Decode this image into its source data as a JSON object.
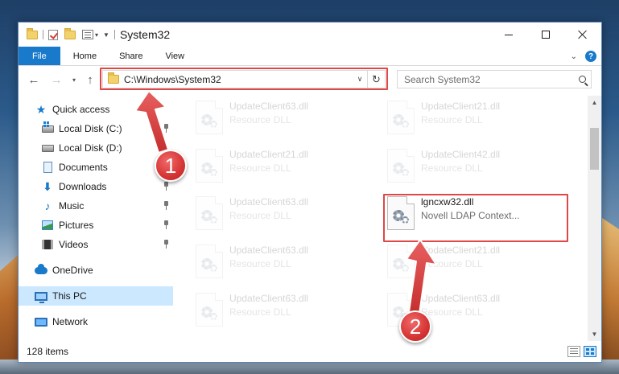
{
  "window": {
    "title": "System32"
  },
  "ribbon": {
    "tabs": [
      {
        "label": "File"
      },
      {
        "label": "Home"
      },
      {
        "label": "Share"
      },
      {
        "label": "View"
      }
    ],
    "help": "?"
  },
  "navbar": {
    "address": "C:\\Windows\\System32",
    "search_placeholder": "Search System32"
  },
  "navpane": {
    "items": [
      {
        "label": "Quick access",
        "icon": "star-icon"
      },
      {
        "label": "Local Disk (C:)",
        "icon": "local-disk-c-icon",
        "pinned": true
      },
      {
        "label": "Local Disk (D:)",
        "icon": "local-disk-d-icon"
      },
      {
        "label": "Documents",
        "icon": "documents-icon",
        "pinned": true
      },
      {
        "label": "Downloads",
        "icon": "downloads-icon",
        "pinned": true
      },
      {
        "label": "Music",
        "icon": "music-icon",
        "pinned": true
      },
      {
        "label": "Pictures",
        "icon": "pictures-icon",
        "pinned": true
      },
      {
        "label": "Videos",
        "icon": "videos-icon",
        "pinned": true
      },
      {
        "label": "OneDrive",
        "icon": "onedrive-icon"
      },
      {
        "label": "This PC",
        "icon": "this-pc-icon",
        "selected": true
      },
      {
        "label": "Network",
        "icon": "network-icon"
      }
    ]
  },
  "files": [
    {
      "name": "UpdateClient63.dll",
      "type": "Resource DLL",
      "faded": true
    },
    {
      "name": "UpdateClient21.dll",
      "type": "Resource DLL",
      "faded": true
    },
    {
      "name": "UpdateClient21.dll",
      "type": "Resource DLL",
      "faded": true
    },
    {
      "name": "UpdateClient42.dll",
      "type": "Resource DLL",
      "faded": true
    },
    {
      "name": "UpdateClient63.dll",
      "type": "Resource DLL",
      "faded": true
    },
    {
      "name": "lgncxw32.dll",
      "type": "Novell LDAP Context...",
      "faded": false
    },
    {
      "name": "UpdateClient63.dll",
      "type": "Resource DLL",
      "faded": true
    },
    {
      "name": "UpdateClient21.dll",
      "type": "Resource DLL",
      "faded": true
    },
    {
      "name": "UpdateClient63.dll",
      "type": "Resource DLL",
      "faded": true
    },
    {
      "name": "UpdateClient63.dll",
      "type": "Resource DLL",
      "faded": true
    }
  ],
  "status": {
    "item_count": "128 items"
  },
  "annotations": {
    "step1": "1",
    "step2": "2",
    "color": "#e04848"
  },
  "colors": {
    "accent": "#1979ca",
    "selected_bg": "#cce8ff"
  }
}
